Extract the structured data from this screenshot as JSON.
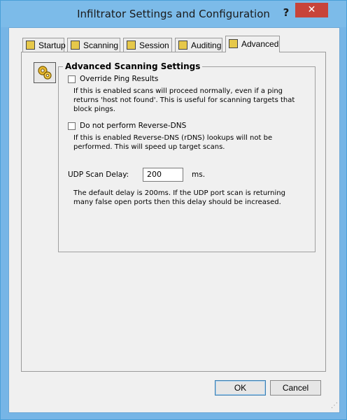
{
  "window": {
    "title": "Infiltrator Settings and Configuration",
    "help": "?",
    "close": "✕"
  },
  "tabs": [
    {
      "label": "Startup",
      "icon": "startup-icon",
      "active": false
    },
    {
      "label": "Scanning",
      "icon": "scanning-icon",
      "active": false
    },
    {
      "label": "Session",
      "icon": "session-icon",
      "active": false
    },
    {
      "label": "Auditing",
      "icon": "auditing-icon",
      "active": false
    },
    {
      "label": "Advanced",
      "icon": "advanced-icon",
      "active": true
    }
  ],
  "advanced": {
    "group_title": "Advanced Scanning Settings",
    "override_ping": {
      "label": "Override Ping Results",
      "checked": false,
      "description": "If this is enabled scans will proceed normally, even if a ping returns 'host not found'. This is useful for scanning targets that block pings."
    },
    "no_rdns": {
      "label": "Do not perform Reverse-DNS",
      "checked": false,
      "description": "If this is enabled Reverse-DNS (rDNS) lookups will not be performed. This will speed up target scans."
    },
    "udp_delay": {
      "label": "UDP Scan Delay:",
      "value": "200",
      "unit": "ms.",
      "description": "The default delay is 200ms. If the UDP port scan is returning many false open ports then this delay should be increased."
    }
  },
  "buttons": {
    "ok": "OK",
    "cancel": "Cancel"
  },
  "colors": {
    "titlebar": "#7cbbe9",
    "close": "#c7443a",
    "face": "#f0f0f0"
  }
}
